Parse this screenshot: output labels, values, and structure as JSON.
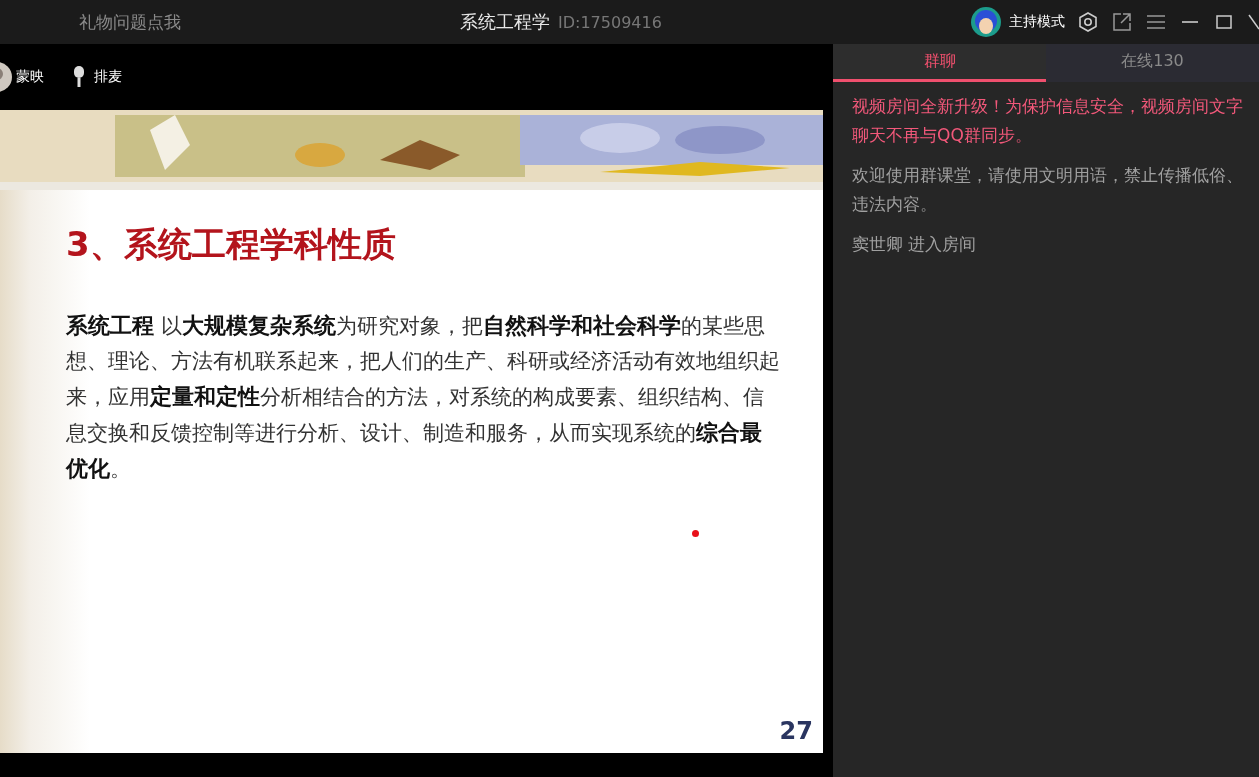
{
  "window": {
    "gift_link": "礼物问题点我",
    "title": "系统工程学",
    "room_id": "ID:17509416",
    "host_mode": "主持模式"
  },
  "stage": {
    "presenter": "蒙映",
    "queue_label": "排麦"
  },
  "slide": {
    "heading": "3、系统工程学科性质",
    "body": "**系统工程** 以**大规模复杂系统**为研究对象，把**自然科学和社会科学**的某些思想、理论、方法有机联系起来，把人们的生产、科研或经济活动有效地组织起来，应用**定量和定性**分析相结合的方法，对系统的构成要素、组织结构、信息交换和反馈控制等进行分析、设计、制造和服务，从而实现系统的**综合最优化**。",
    "page": "27"
  },
  "tabs": [
    {
      "label": "群聊",
      "selected": true
    },
    {
      "label": "在线130",
      "selected": false
    }
  ],
  "messages": [
    {
      "kind": "notice",
      "text": "视频房间全新升级！为保护信息安全，视频房间文字聊天不再与QQ群同步。"
    },
    {
      "kind": "system",
      "text": "欢迎使用群课堂，请使用文明用语，禁止传播低俗、违法内容。"
    },
    {
      "kind": "system",
      "text": "窦世卿 进入房间"
    }
  ]
}
